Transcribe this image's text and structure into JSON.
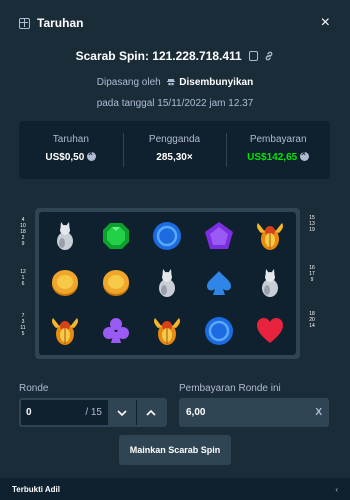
{
  "header": {
    "title": "Taruhan",
    "close_label": "×"
  },
  "bet": {
    "spin_title": "Scarab Spin: 121.228.718.411",
    "placed_by_prefix": "Dipasang oleh",
    "placed_by_user": "Disembunyikan",
    "date": "pada tanggal 15/11/2022 jam 12.37"
  },
  "stats": [
    {
      "label": "Taruhan",
      "value": "US$0,50",
      "currency_icon": "coin-icon",
      "color": "#ffffff"
    },
    {
      "label": "Pengganda",
      "value": "285,30×",
      "currency_icon": "",
      "color": "#ffffff"
    },
    {
      "label": "Pembayaran",
      "value": "US$142,65",
      "currency_icon": "coin-icon",
      "color": "#00e701"
    }
  ],
  "paylines": {
    "left_top": [
      "4",
      "10",
      "18",
      "2",
      "9"
    ],
    "left_mid": [
      "12",
      "1",
      "6"
    ],
    "left_bot": [
      "7",
      "3",
      "11",
      "5"
    ],
    "right_top": [
      "15",
      "13",
      "19"
    ],
    "right_mid": [
      "16",
      "17",
      "9"
    ],
    "right_bot": [
      "18",
      "20",
      "14"
    ]
  },
  "board": {
    "rows": [
      [
        "cat",
        "green-gem",
        "blue-ring",
        "purple-pentagon",
        "scarab"
      ],
      [
        "gold-coin",
        "gold-coin",
        "cat",
        "spade",
        "cat"
      ],
      [
        "scarab",
        "club",
        "scarab",
        "blue-ring",
        "heart"
      ]
    ]
  },
  "controls": {
    "round_label": "Ronde",
    "round_value": "0",
    "round_total": "/ 15",
    "round_payout_label": "Pembayaran Ronde ini",
    "round_payout_value": "6,00",
    "clear_label": "X"
  },
  "play_button": "Mainkan Scarab Spin",
  "footer": {
    "label": "Terbukti Adil",
    "chevron": "‹"
  }
}
